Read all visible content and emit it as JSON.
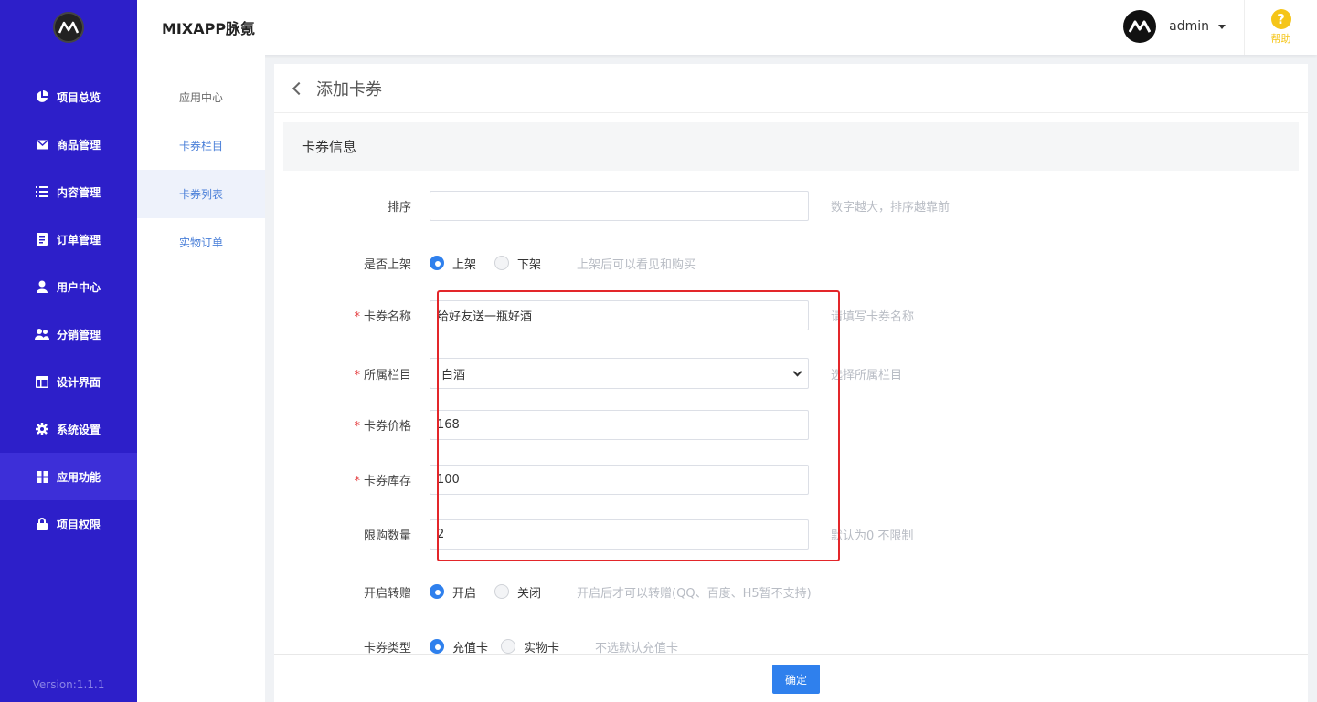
{
  "sidebar": {
    "version": "Version:1.1.1",
    "items": [
      {
        "label": "项目总览",
        "icon": "pie-chart-icon"
      },
      {
        "label": "商品管理",
        "icon": "envelope-icon"
      },
      {
        "label": "内容管理",
        "icon": "list-icon"
      },
      {
        "label": "订单管理",
        "icon": "document-icon"
      },
      {
        "label": "用户中心",
        "icon": "user-icon"
      },
      {
        "label": "分销管理",
        "icon": "users-icon"
      },
      {
        "label": "设计界面",
        "icon": "layout-icon"
      },
      {
        "label": "系统设置",
        "icon": "gear-icon"
      },
      {
        "label": "应用功能",
        "icon": "grid-icon",
        "active": true
      },
      {
        "label": "项目权限",
        "icon": "lock-icon"
      }
    ]
  },
  "header": {
    "app_title": "MIXAPP脉氪",
    "user_name": "admin",
    "help_label": "帮助",
    "help_glyph": "?"
  },
  "subnav": {
    "items": [
      {
        "label": "应用中心"
      },
      {
        "label": "卡券栏目"
      },
      {
        "label": "卡券列表",
        "active": true
      },
      {
        "label": "实物订单"
      }
    ]
  },
  "page": {
    "title": "添加卡券",
    "section_title": "卡券信息"
  },
  "form": {
    "sort": {
      "label": "排序",
      "value": "",
      "hint": "数字越大，排序越靠前"
    },
    "on_shelf": {
      "label": "是否上架",
      "options": [
        "上架",
        "下架"
      ],
      "selected": "上架",
      "hint": "上架后可以看见和购买"
    },
    "name": {
      "label": "卡券名称",
      "value": "给好友送一瓶好酒",
      "hint": "请填写卡券名称"
    },
    "category": {
      "label": "所属栏目",
      "value": "白酒",
      "hint": "选择所属栏目"
    },
    "price": {
      "label": "卡券价格",
      "value": "168"
    },
    "stock": {
      "label": "卡券库存",
      "value": "100"
    },
    "limit": {
      "label": "限购数量",
      "value": "2",
      "hint": "默认为0 不限制"
    },
    "transfer": {
      "label": "开启转赠",
      "options": [
        "开启",
        "关闭"
      ],
      "selected": "开启",
      "hint": "开启后才可以转赠(QQ、百度、H5暂不支持)"
    },
    "card_type": {
      "label": "卡券类型",
      "options": [
        "充值卡",
        "实物卡"
      ],
      "selected": "充值卡",
      "hint": "不选默认充值卡"
    },
    "required_mark": "*"
  },
  "footer": {
    "confirm_label": "确定"
  },
  "colors": {
    "sidebar_bg": "#2d1fc9",
    "primary": "#2f80ed",
    "highlight_border": "#e3262a",
    "help_yellow": "#f5c518"
  }
}
